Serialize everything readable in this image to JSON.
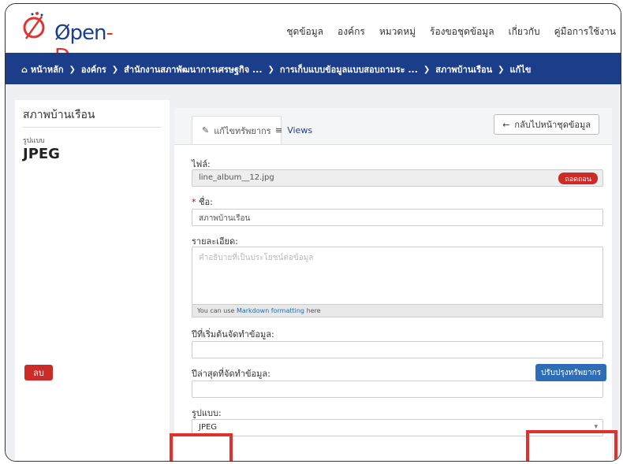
{
  "header": {
    "logo_main": "Øpen",
    "logo_dash": "-D",
    "nav": [
      "ชุดข้อมูล",
      "องค์กร",
      "หมวดหมู่",
      "ร้องขอชุดข้อมูล",
      "เกี่ยวกับ",
      "คู่มือการใช้งาน"
    ]
  },
  "breadcrumb": [
    "หน้าหลัก",
    "องค์กร",
    "สำนักงานสภาพัฒนาการเศรษฐกิจ ...",
    "การเก็บแบบข้อมูลแบบสอบถามระ ...",
    "สภาพบ้านเรือน",
    "แก้ไข"
  ],
  "sidebar": {
    "title": "สภาพบ้านเรือน",
    "format_label": "รูปแบบ",
    "format_value": "JPEG"
  },
  "tabs": {
    "edit": "แก้ไขทรัพยากร",
    "views": "Views"
  },
  "back_button": "กลับไปหน้าชุดข้อมูล",
  "form": {
    "file_label": "ไฟล์:",
    "file_value": "line_album__12.jpg",
    "remove_label": "ถอดถอน",
    "name_label": "ชื่อ:",
    "name_required": "*",
    "name_value": "สภาพบ้านเรือน",
    "desc_label": "รายละเอียด:",
    "desc_placeholder": "คำอธิบายที่เป็นประโยชน์ต่อข้อมูล",
    "markdown_prefix": "You can use",
    "markdown_link": "Markdown formatting",
    "markdown_suffix": "here",
    "start_label": "ปีที่เริ่มต้นจัดทำข้อมูล:",
    "end_label": "ปีล่าสุดที่จัดทำข้อมูล:",
    "format_label": "รูปแบบ:",
    "format_value": "JPEG"
  },
  "actions": {
    "delete": "ลบ",
    "update": "ปรับปรุงทรัพยากร"
  },
  "colors": {
    "brand_blue": "#1c3d8a",
    "danger": "#cc2b27",
    "primary": "#2c6db5",
    "highlight": "#e0312d"
  }
}
